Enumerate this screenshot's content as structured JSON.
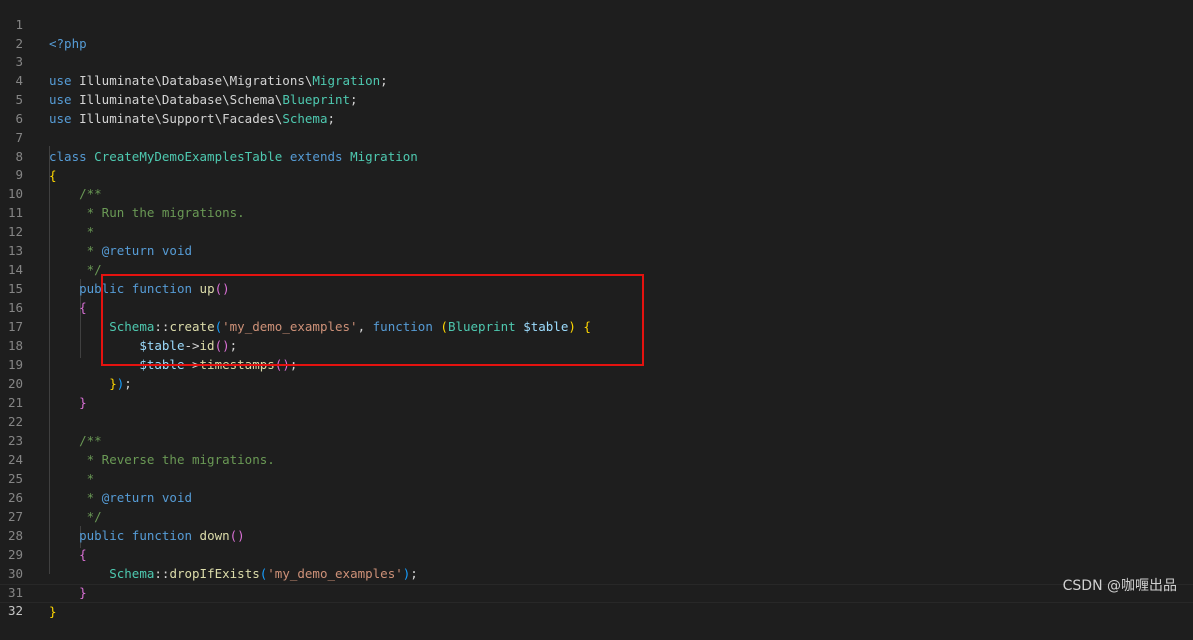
{
  "editor": {
    "line_numbers": [
      "1",
      "2",
      "3",
      "4",
      "5",
      "6",
      "7",
      "8",
      "9",
      "10",
      "11",
      "12",
      "13",
      "14",
      "15",
      "16",
      "17",
      "18",
      "19",
      "20",
      "21",
      "22",
      "23",
      "24",
      "25",
      "26",
      "27",
      "28",
      "29",
      "30",
      "31",
      "32"
    ],
    "active_line": "32",
    "tokens": {
      "open_tag": "<?php",
      "use": "use",
      "ns_migrations": "Illuminate\\Database\\Migrations\\",
      "cls_migration": "Migration",
      "ns_schema": "Illuminate\\Database\\Schema\\",
      "cls_blueprint": "Blueprint",
      "ns_facades": "Illuminate\\Support\\Facades\\",
      "cls_schema": "Schema",
      "semi": ";",
      "class_kw": "class",
      "class_name": "CreateMyDemoExamplesTable",
      "extends_kw": "extends",
      "brace_open": "{",
      "brace_close": "}",
      "doc_open": "/**",
      "doc_run": " * Run the migrations.",
      "doc_star": " *",
      "doc_star_sp": " * ",
      "doc_return": "@return",
      "doc_void": " void",
      "doc_close": " */",
      "public_kw": "public",
      "function_kw": "function",
      "fn_up": "up",
      "parens": "()",
      "paren_open": "(",
      "paren_close": ")",
      "double_colon": "::",
      "fn_create": "create",
      "str_table": "'my_demo_examples'",
      "comma": ", ",
      "space_paren": " (",
      "var_table": "$table",
      "arrow": "->",
      "fn_id": "id",
      "fn_timestamps": "timestamps",
      "close_paren_semi": ");",
      "doc_reverse": " * Reverse the migrations.",
      "fn_down": "down",
      "fn_drop": "dropIfExists"
    }
  },
  "watermark": "CSDN @咖喱出品"
}
